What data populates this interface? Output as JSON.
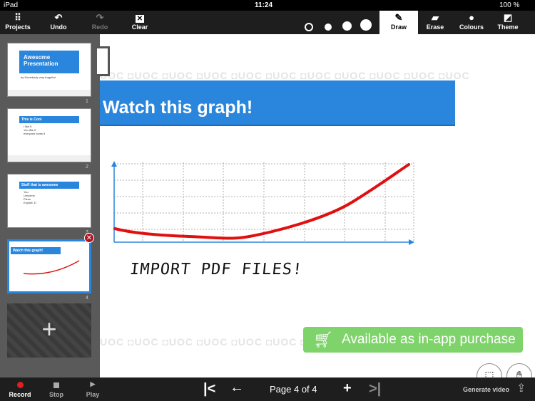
{
  "status": {
    "device": "iPad",
    "time": "11:24",
    "battery": "100 %"
  },
  "toolbar": {
    "projects": "Projects",
    "undo": "Undo",
    "redo": "Redo",
    "clear": "Clear",
    "draw": "Draw",
    "erase": "Erase",
    "colours": "Colours",
    "theme": "Theme"
  },
  "slides": [
    {
      "num": "1",
      "title": "Awesome Presentation",
      "lines": [
        "by Somebody very forgetful"
      ]
    },
    {
      "num": "2",
      "title": "This is Cool",
      "lines": [
        "I like it",
        "You like it",
        "everyone loves it"
      ]
    },
    {
      "num": "3",
      "title": "Stuff that is awesome",
      "lines": [
        "You",
        "Unicorns",
        "Pizza",
        "Explicit :D"
      ]
    },
    {
      "num": "4",
      "title": "Watch this graph!",
      "lines": []
    }
  ],
  "add_slide": "+",
  "canvas": {
    "watermark": "UOC ◘UOC ◘UOC ◘UOC ◘UOC ◘UOC ◘UOC ◘UOC ◘UOC ◘UOC ◘UOC",
    "title": "Watch this graph!",
    "handwriting": "IMPORT  PDF FILES!",
    "purchase": "Available as in-app purchase"
  },
  "bottom": {
    "record": "Record",
    "stop": "Stop",
    "play": "Play",
    "page": "Page 4 of 4",
    "generate": "Generate video"
  },
  "colors": {
    "accent": "#2a86dc",
    "purchase": "#7ed36a",
    "record": "#e02020",
    "pen": "#e01010"
  }
}
